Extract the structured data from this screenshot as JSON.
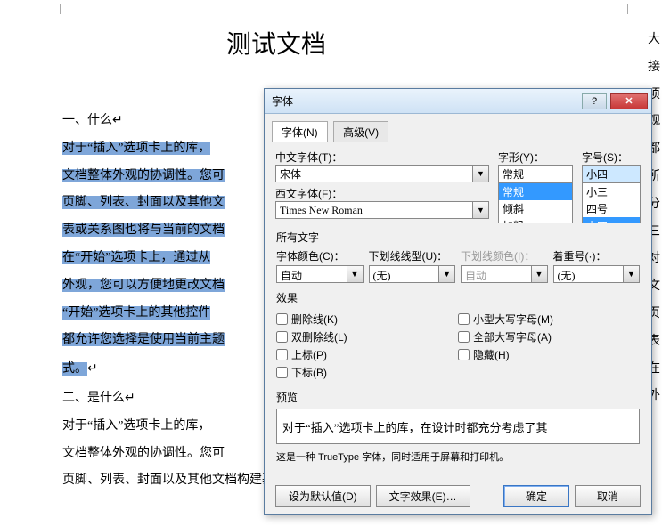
{
  "doc": {
    "title": "测试文档",
    "h1": "一、什么",
    "p1": "对于“插入”选项卡上的库，",
    "p2": "文档整体外观的协调性。您可",
    "p3": "页脚、列表、封面以及其他文",
    "p4": "表或关系图也将与当前的文档",
    "p5": "在“开始”选项卡上，通过从",
    "p6": "外观，您可以方便地更改文档",
    "p7": "“开始”选项卡上的其他控件",
    "p8": "都允许您选择是使用当前主题",
    "p9": "式。",
    "h2": "二、是什么",
    "p10": "对于“插入”选项卡上的库，",
    "p11": "文档整体外观的协调性。您可",
    "p12": "页脚、列表、封面以及其他文档构建基块。 您创建的图片、图",
    "right_clip": "大接项观都所分三对文页表在外"
  },
  "dialog": {
    "title": "字体",
    "tabs": {
      "font": "字体(N)",
      "advanced": "高级(V)"
    },
    "labels": {
      "cn_font": "中文字体(T)：",
      "en_font": "西文字体(F)：",
      "style": "字形(Y)：",
      "size": "字号(S)：",
      "all_text": "所有文字",
      "font_color": "字体颜色(C)：",
      "underline": "下划线线型(U)：",
      "underline_color": "下划线颜色(I)：",
      "emphasis": "着重号(·)：",
      "effects": "效果",
      "preview": "预览"
    },
    "values": {
      "cn_font": "宋体",
      "en_font": "Times New Roman",
      "style": "常规",
      "size": "小四",
      "font_color": "自动",
      "underline": "(无)",
      "underline_color": "自动",
      "emphasis": "(无)"
    },
    "style_list": [
      "常规",
      "倾斜",
      "加粗"
    ],
    "size_list": [
      "小三",
      "四号",
      "小四"
    ],
    "effects_cb": {
      "strike": "删除线(K)",
      "dstrike": "双删除线(L)",
      "super": "上标(P)",
      "sub": "下标(B)",
      "small_caps": "小型大写字母(M)",
      "all_caps": "全部大写字母(A)",
      "hidden": "隐藏(H)"
    },
    "preview_text": "对于“插入”选项卡上的库，在设计时都充分考虑了其",
    "hint": "这是一种 TrueType 字体，同时适用于屏幕和打印机。",
    "buttons": {
      "default": "设为默认值(D)",
      "text_effects": "文字效果(E)…",
      "ok": "确定",
      "cancel": "取消"
    }
  }
}
